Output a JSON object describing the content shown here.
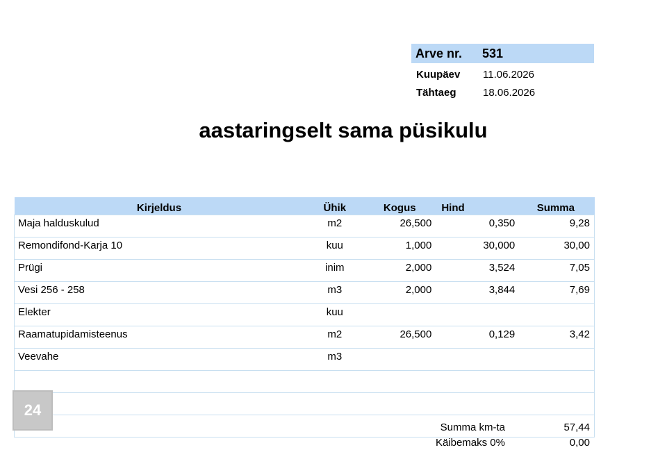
{
  "invoice": {
    "number_label": "Arve nr.",
    "number": "531"
  },
  "meta": [
    {
      "label": "Kuupäev",
      "value": "11.06.2026"
    },
    {
      "label": "Tähtaeg",
      "value": "18.06.2026"
    }
  ],
  "title": "aastaringselt sama püsikulu",
  "table": {
    "headers": [
      "Kirjeldus",
      "Ühik",
      "Kogus",
      "Hind",
      "Summa"
    ],
    "rows": [
      [
        "Maja halduskulud",
        "m2",
        "26,500",
        "0,350",
        "9,28"
      ],
      [
        "Remondifond-Karja 10",
        "kuu",
        "1,000",
        "30,000",
        "30,00"
      ],
      [
        "Prügi",
        "inim",
        "2,000",
        "3,524",
        "7,05"
      ],
      [
        "Vesi  256 - 258",
        "m3",
        "2,000",
        "3,844",
        "7,69"
      ],
      [
        "Elekter",
        "kuu",
        "",
        "",
        ""
      ],
      [
        "Raamatupidamisteenus",
        "m2",
        "26,500",
        "0,129",
        "3,42"
      ],
      [
        "Veevahe",
        "m3",
        "",
        "",
        ""
      ],
      [
        "",
        "",
        "",
        "",
        ""
      ],
      [
        "",
        "",
        "",
        "",
        ""
      ],
      [
        "",
        "",
        "",
        "",
        ""
      ]
    ]
  },
  "totals": [
    {
      "label": "Summa km-ta",
      "value": "57,44"
    },
    {
      "label": "Käibemaks 0%",
      "value": "0,00"
    }
  ],
  "badge": "24"
}
